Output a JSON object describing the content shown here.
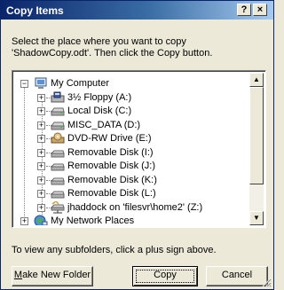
{
  "window": {
    "title": "Copy Items",
    "help_label": "?",
    "close_label": "×"
  },
  "instructions": {
    "line1": "Select the place where you want to copy",
    "line2": "'ShadowCopy.odt'. Then click the Copy button."
  },
  "tree": {
    "root_expander": "−",
    "items": [
      {
        "label": "My Computer",
        "icon": "computer-icon",
        "expander": "−"
      },
      {
        "label": "3½ Floppy (A:)",
        "icon": "floppy-drive-icon",
        "expander": "+"
      },
      {
        "label": "Local Disk (C:)",
        "icon": "hard-disk-icon",
        "expander": "+"
      },
      {
        "label": "MISC_DATA (D:)",
        "icon": "hard-disk-icon",
        "expander": "+"
      },
      {
        "label": "DVD-RW Drive (E:)",
        "icon": "dvd-drive-icon",
        "expander": "+"
      },
      {
        "label": "Removable Disk (I:)",
        "icon": "removable-disk-icon",
        "expander": "+"
      },
      {
        "label": "Removable Disk (J:)",
        "icon": "removable-disk-icon",
        "expander": "+"
      },
      {
        "label": "Removable Disk (K:)",
        "icon": "removable-disk-icon",
        "expander": "+"
      },
      {
        "label": "Removable Disk (L:)",
        "icon": "removable-disk-icon",
        "expander": "+"
      },
      {
        "label": "jhaddock on 'filesvr\\home2' (Z:)",
        "icon": "network-drive-icon",
        "expander": "+"
      },
      {
        "label": "My Network Places",
        "icon": "network-places-icon",
        "expander": "+"
      }
    ]
  },
  "scrollbar": {
    "up_arrow": "▲",
    "down_arrow": "▼"
  },
  "hint": "To view any subfolders, click a plus sign above.",
  "buttons": {
    "make_new_folder_u": "M",
    "make_new_folder_rest": "ake New Folder",
    "copy": "Copy",
    "cancel": "Cancel"
  },
  "colors": {
    "title_bar_start": "#0a246a",
    "title_bar_end": "#a6caf0",
    "dialog_face": "#ece9d8"
  }
}
